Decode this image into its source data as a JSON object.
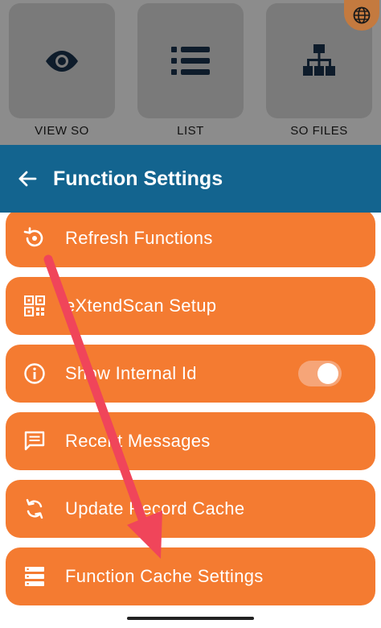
{
  "background_tiles": [
    {
      "label": "VIEW SO",
      "icon": "eye-icon"
    },
    {
      "label": "LIST",
      "icon": "list-icon"
    },
    {
      "label": "SO FILES",
      "icon": "sitemap-icon"
    }
  ],
  "header": {
    "title": "Function Settings",
    "back_icon": "arrow-left-icon"
  },
  "menu": {
    "items": [
      {
        "label": "Refresh Functions",
        "icon": "refresh-icon"
      },
      {
        "label": "eXtendScan Setup",
        "icon": "qr-code-icon"
      },
      {
        "label": "Show Internal Id",
        "icon": "info-icon",
        "toggle_on": true
      },
      {
        "label": "Recent Messages",
        "icon": "message-icon"
      },
      {
        "label": "Update Record Cache",
        "icon": "sync-icon"
      },
      {
        "label": "Function Cache Settings",
        "icon": "storage-icon"
      }
    ]
  },
  "colors": {
    "header": "#13648f",
    "item": "#f47b31",
    "annotation_arrow": "#f0455a"
  }
}
